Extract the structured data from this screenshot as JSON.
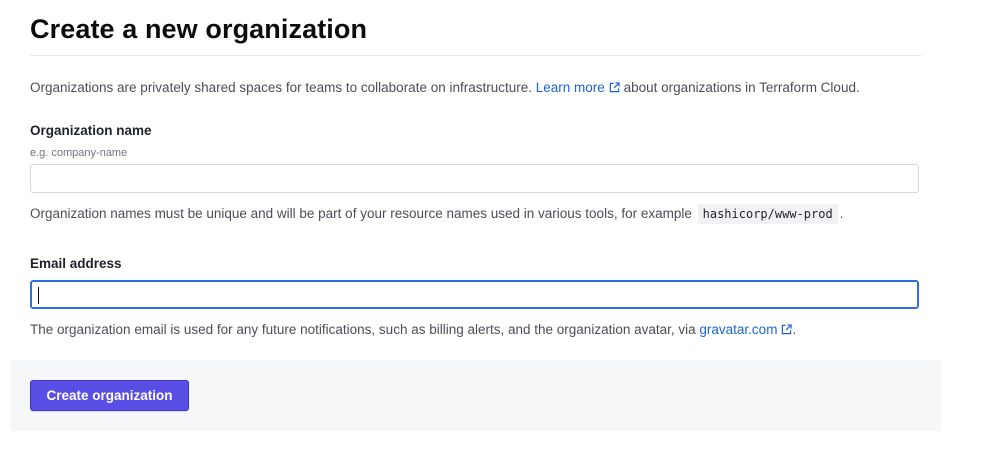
{
  "page": {
    "title": "Create a new organization"
  },
  "intro": {
    "text_before": "Organizations are privately shared spaces for teams to collaborate on infrastructure.",
    "link_label": "Learn more",
    "text_after": "about organizations in Terraform Cloud."
  },
  "org_name": {
    "label": "Organization name",
    "hint": "e.g. company-name",
    "value": "",
    "help_before": "Organization names must be unique and will be part of your resource names used in various tools, for example",
    "example_code": "hashicorp/www-prod",
    "help_after": "."
  },
  "email": {
    "label": "Email address",
    "value": "",
    "help_before": "The organization email is used for any future notifications, such as billing alerts, and the organization avatar, via",
    "link_label": "gravatar.com",
    "help_after": "."
  },
  "actions": {
    "create_label": "Create organization"
  },
  "icons": {
    "external_link": "external-link-icon"
  },
  "colors": {
    "link": "#1d63d6",
    "primary_button": "#5a4fe4",
    "focus_border": "#2e6fdc"
  }
}
